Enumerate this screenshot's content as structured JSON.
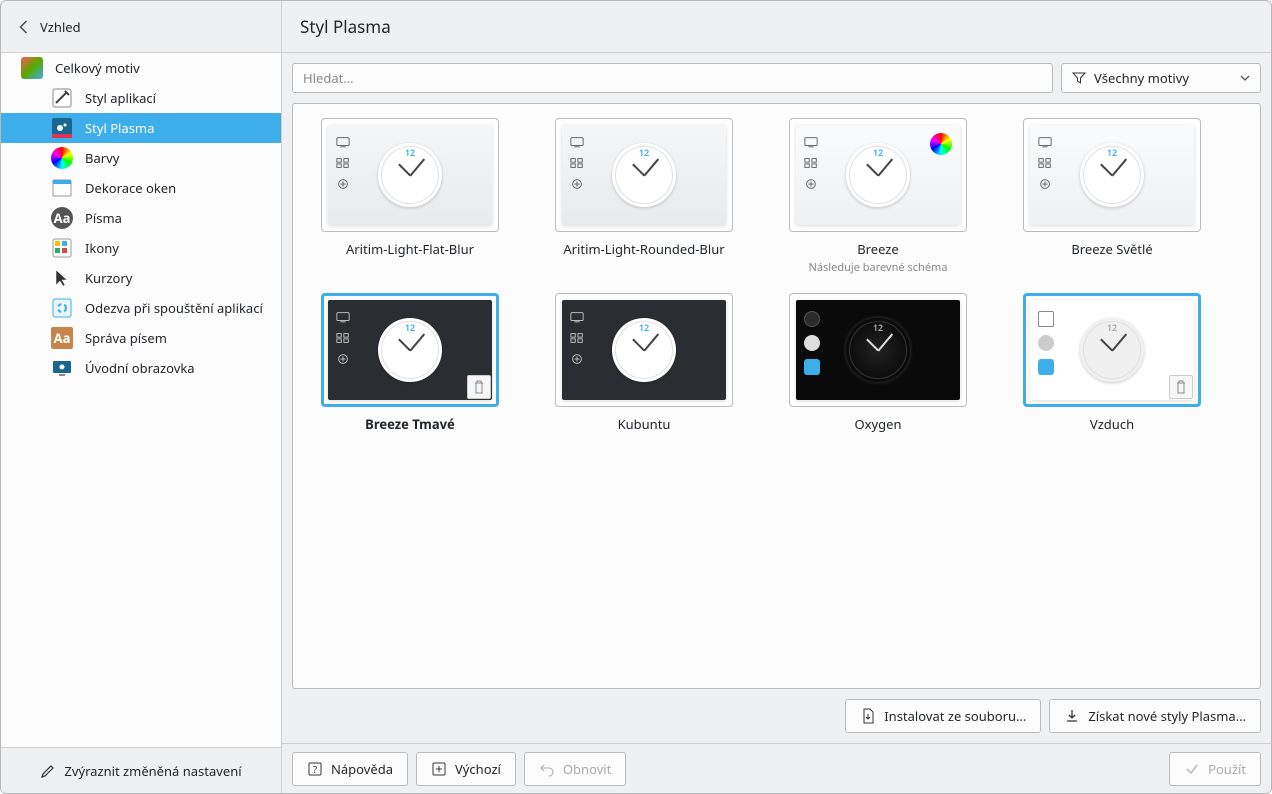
{
  "header": {
    "back_label": "Vzhled",
    "title": "Styl Plasma"
  },
  "sidebar": {
    "items": [
      {
        "label": "Celkový motiv"
      },
      {
        "label": "Styl aplikací"
      },
      {
        "label": "Styl Plasma"
      },
      {
        "label": "Barvy"
      },
      {
        "label": "Dekorace oken"
      },
      {
        "label": "Písma"
      },
      {
        "label": "Ikony"
      },
      {
        "label": "Kurzory"
      },
      {
        "label": "Odezva při spouštění aplikací"
      },
      {
        "label": "Správa písem"
      },
      {
        "label": "Úvodní obrazovka"
      }
    ],
    "footer": "Zvýraznit změněná nastavení"
  },
  "search": {
    "placeholder": "Hledat…"
  },
  "filter": {
    "label": "Všechny motivy"
  },
  "themes": [
    {
      "name": "Aritim-Light-Flat-Blur",
      "sub": ""
    },
    {
      "name": "Aritim-Light-Rounded-Blur",
      "sub": ""
    },
    {
      "name": "Breeze",
      "sub": "Následuje barevné schéma"
    },
    {
      "name": "Breeze Světlé",
      "sub": ""
    },
    {
      "name": "Breeze Tmavé",
      "sub": ""
    },
    {
      "name": "Kubuntu",
      "sub": ""
    },
    {
      "name": "Oxygen",
      "sub": ""
    },
    {
      "name": "Vzduch",
      "sub": ""
    }
  ],
  "actions": {
    "install": "Instalovat ze souboru…",
    "get_new": "Získat nové styly Plasma…",
    "help": "Nápověda",
    "defaults": "Výchozí",
    "reset": "Obnovit",
    "apply": "Použít"
  }
}
